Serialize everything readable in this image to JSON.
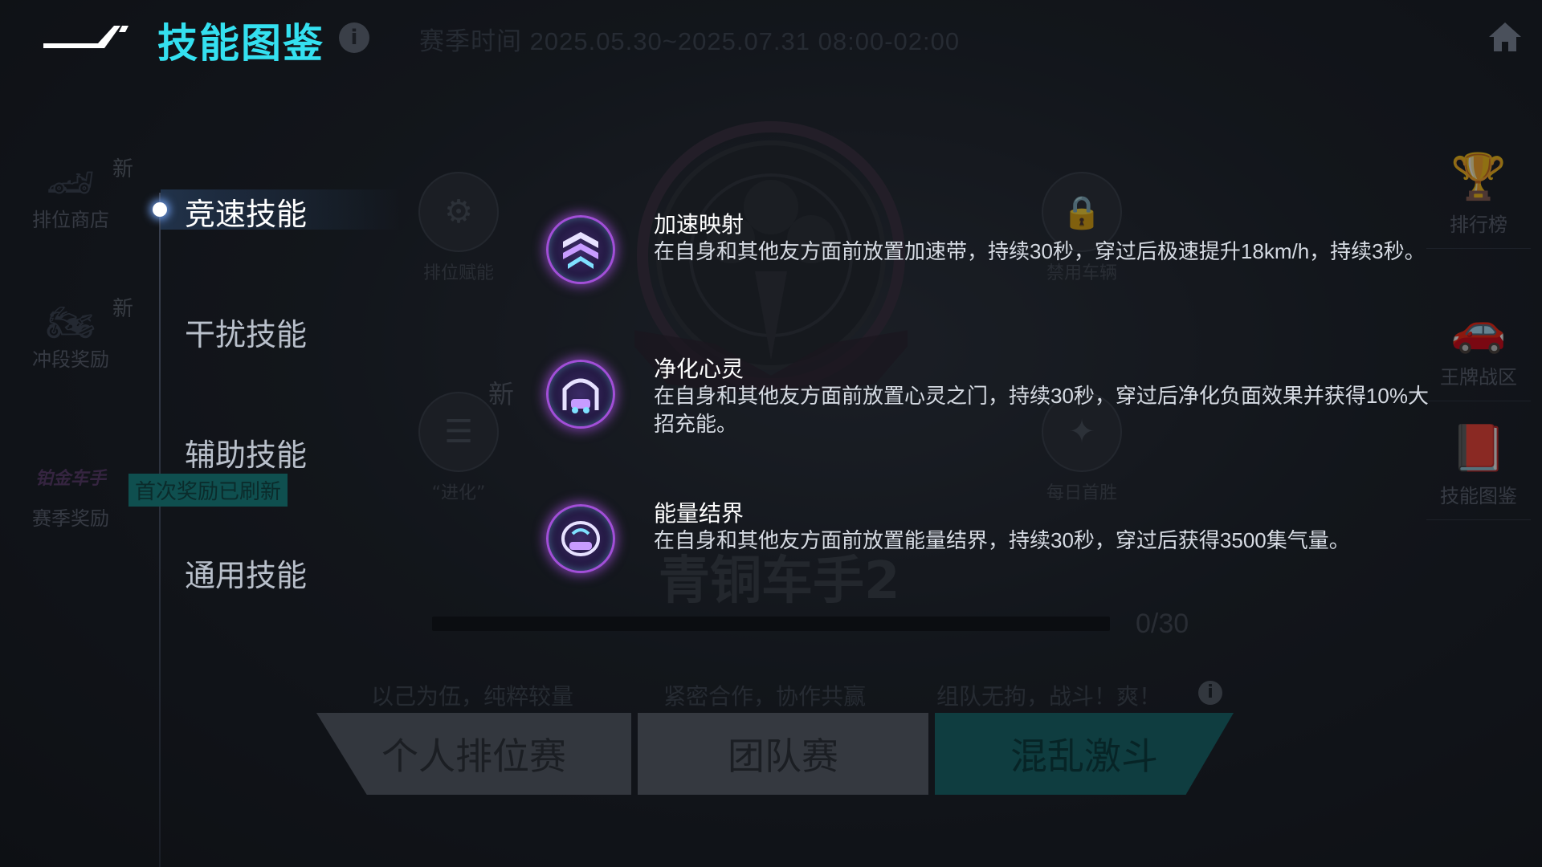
{
  "header": {
    "title": "技能图鉴",
    "season_time": "赛季时间 2025.05.30~2025.07.31 08:00-02:00"
  },
  "left_menu": [
    {
      "label": "排位商店",
      "new": "新"
    },
    {
      "label": "冲段奖励",
      "new": "新"
    },
    {
      "label": "赛季奖励",
      "brand": "铂金车手"
    }
  ],
  "right_menu": [
    {
      "label": "排行榜"
    },
    {
      "label": "王牌战区"
    },
    {
      "label": "技能图鉴"
    }
  ],
  "background": {
    "nodes": [
      {
        "label": "排位赋能"
      },
      {
        "label": "“进化”",
        "new": "新"
      },
      {
        "label": "禁用车辆"
      },
      {
        "label": "每日首胜"
      }
    ],
    "rank_name": "青铜车手2",
    "progress_text": "0/30",
    "progress_fraction": 0,
    "mode_descriptions": [
      "以己为伍，纯粹较量",
      "紧密合作，协作共赢",
      "组队无拘，战斗！爽！"
    ],
    "modes": [
      "个人排位赛",
      "团队赛",
      "混乱激斗"
    ]
  },
  "categories": [
    {
      "label": "竞速技能",
      "active": true
    },
    {
      "label": "干扰技能",
      "active": false
    },
    {
      "label": "辅助技能",
      "active": false
    },
    {
      "label": "通用技能",
      "active": false
    }
  ],
  "first_reward_badge": "首次奖励已刷新",
  "skills": [
    {
      "name": "加速映射",
      "desc": "在自身和其他友方面前放置加速带，持续30秒，穿过后极速提升18km/h，持续3秒。",
      "icon": "speed-chevron-icon"
    },
    {
      "name": "净化心灵",
      "desc": "在自身和其他友方面前放置心灵之门，持续30秒，穿过后净化负面效果并获得10%大招充能。",
      "icon": "gate-car-icon"
    },
    {
      "name": "能量结界",
      "desc": "在自身和其他友方面前放置能量结界，持续30秒，穿过后获得3500集气量。",
      "icon": "energy-barrier-icon"
    }
  ],
  "colors": {
    "title_accent": "#34e0f0",
    "skill_icon_border": "#a24fd8",
    "chaos_mode": "#14676b"
  }
}
